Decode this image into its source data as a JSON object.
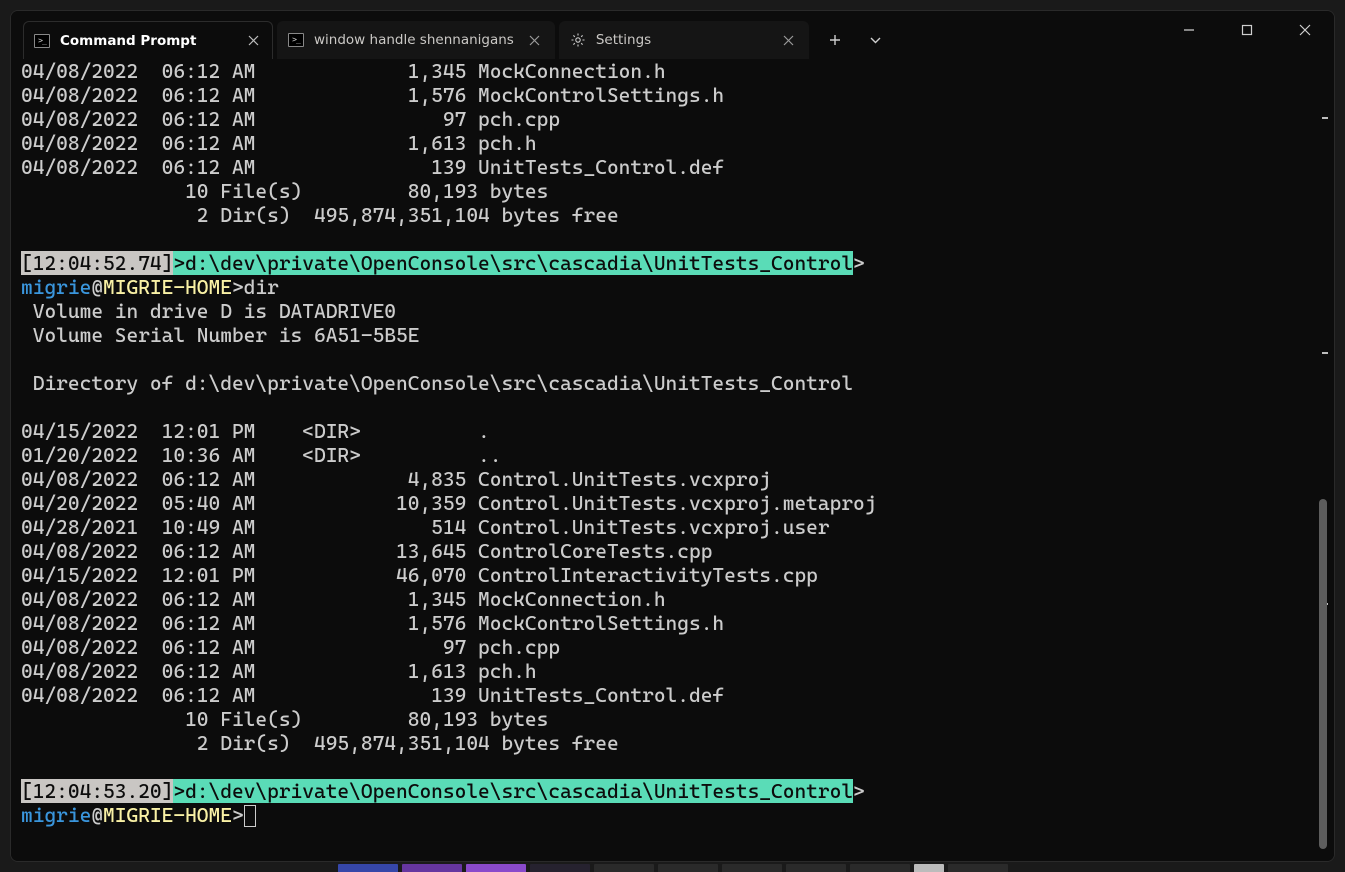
{
  "tabs": [
    {
      "title": "Command Prompt",
      "icon": "cmd",
      "active": true
    },
    {
      "title": "window handle shennanigans",
      "icon": "cmd",
      "active": false
    },
    {
      "title": "Settings",
      "icon": "gear",
      "active": false
    }
  ],
  "terminal": {
    "top_rows": [
      "04/08/2022  06:12 AM             1,345 MockConnection.h",
      "04/08/2022  06:12 AM             1,576 MockControlSettings.h",
      "04/08/2022  06:12 AM                97 pch.cpp",
      "04/08/2022  06:12 AM             1,613 pch.h",
      "04/08/2022  06:12 AM               139 UnitTests_Control.def",
      "              10 File(s)         80,193 bytes",
      "               2 Dir(s)  495,874,351,104 bytes free"
    ],
    "prompt1": {
      "timestamp": "[12:04:52.74]",
      "path": "d:\\dev\\private\\OpenConsole\\src\\cascadia\\UnitTests_Control",
      "user": "migrie",
      "host": "MIGRIE-HOME",
      "cmd": "dir"
    },
    "mid_rows": [
      " Volume in drive D is DATADRIVE0",
      " Volume Serial Number is 6A51-5B5E",
      "",
      " Directory of d:\\dev\\private\\OpenConsole\\src\\cascadia\\UnitTests_Control",
      "",
      "04/15/2022  12:01 PM    <DIR>          .",
      "01/20/2022  10:36 AM    <DIR>          ..",
      "04/08/2022  06:12 AM             4,835 Control.UnitTests.vcxproj",
      "04/20/2022  05:40 AM            10,359 Control.UnitTests.vcxproj.metaproj",
      "04/28/2021  10:49 AM               514 Control.UnitTests.vcxproj.user",
      "04/08/2022  06:12 AM            13,645 ControlCoreTests.cpp",
      "04/15/2022  12:01 PM            46,070 ControlInteractivityTests.cpp",
      "04/08/2022  06:12 AM             1,345 MockConnection.h",
      "04/08/2022  06:12 AM             1,576 MockControlSettings.h",
      "04/08/2022  06:12 AM                97 pch.cpp",
      "04/08/2022  06:12 AM             1,613 pch.h",
      "04/08/2022  06:12 AM               139 UnitTests_Control.def",
      "              10 File(s)         80,193 bytes",
      "               2 Dir(s)  495,874,351,104 bytes free"
    ],
    "prompt2": {
      "timestamp": "[12:04:53.20]",
      "path": "d:\\dev\\private\\OpenConsole\\src\\cascadia\\UnitTests_Control",
      "user": "migrie",
      "host": "MIGRIE-HOME",
      "cmd": ""
    },
    "gt": ">",
    "at": "@"
  }
}
